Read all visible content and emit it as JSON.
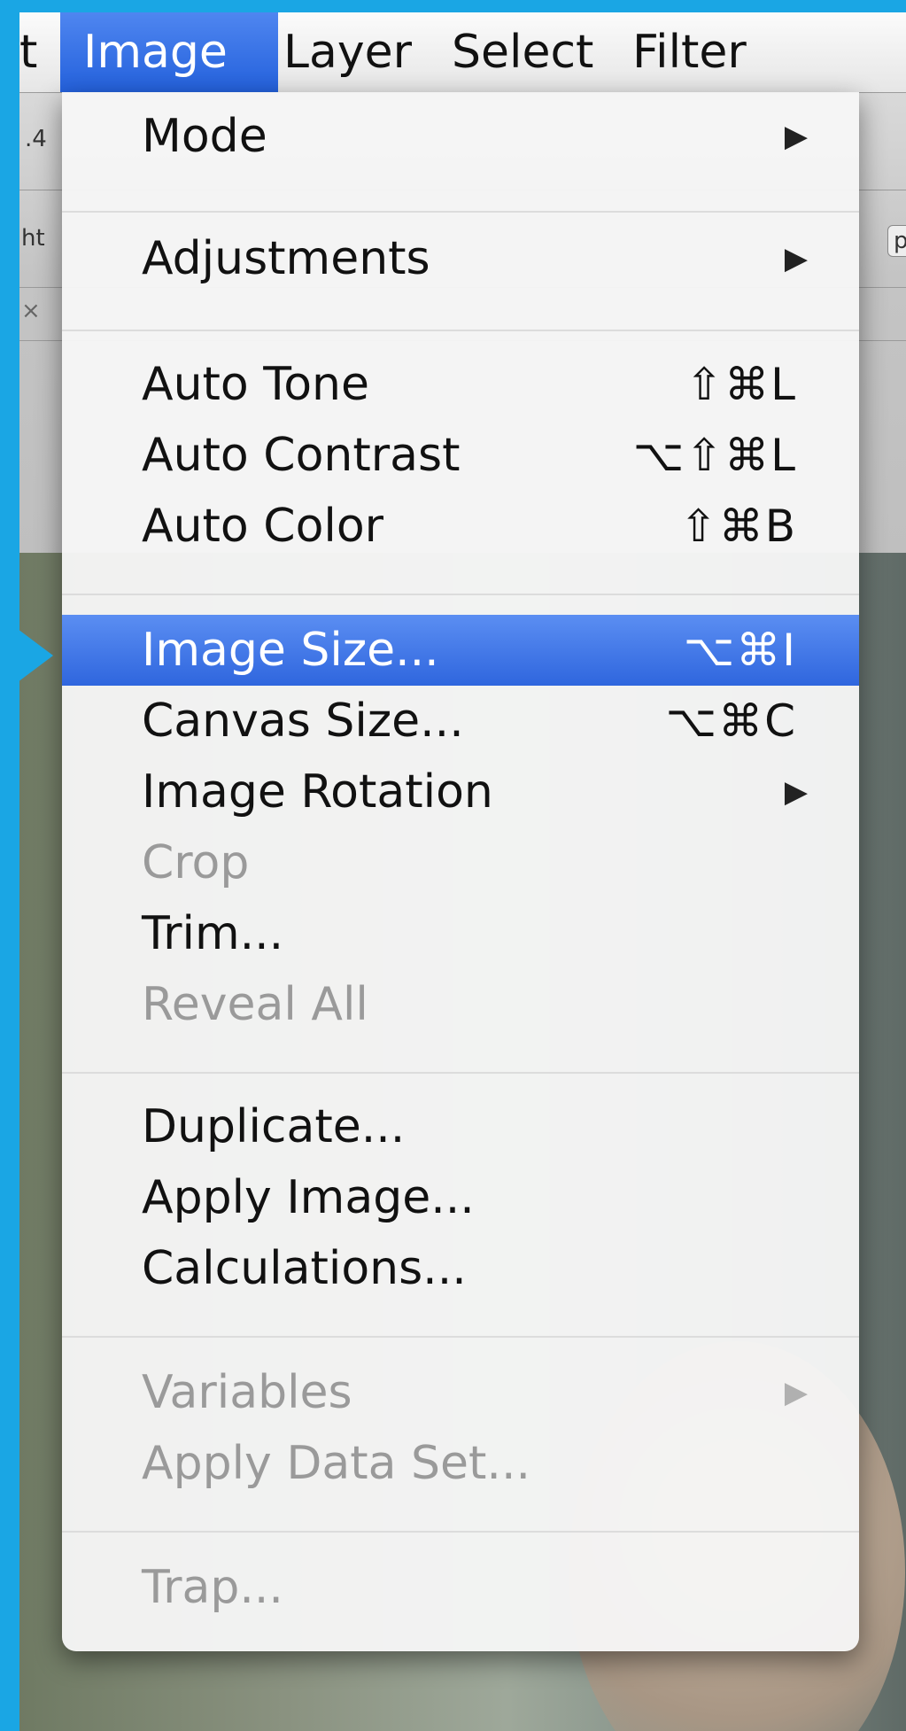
{
  "menubar": {
    "items": [
      {
        "label": "t"
      },
      {
        "label": "Image"
      },
      {
        "label": "Layer"
      },
      {
        "label": "Select"
      },
      {
        "label": "Filter"
      }
    ]
  },
  "background_fragments": {
    "toolbar_value": ".4",
    "option_text": "ht",
    "button_text": "p",
    "close_glyph": "×"
  },
  "image_menu": {
    "items": [
      {
        "label": "Mode",
        "shortcut": "",
        "submenu": true,
        "enabled": true
      },
      {
        "label": "Adjustments",
        "shortcut": "",
        "submenu": true,
        "enabled": true
      },
      {
        "label": "Auto Tone",
        "shortcut": "⇧⌘L",
        "submenu": false,
        "enabled": true
      },
      {
        "label": "Auto Contrast",
        "shortcut": "⌥⇧⌘L",
        "submenu": false,
        "enabled": true
      },
      {
        "label": "Auto Color",
        "shortcut": "⇧⌘B",
        "submenu": false,
        "enabled": true
      },
      {
        "label": "Image Size...",
        "shortcut": "⌥⌘I",
        "submenu": false,
        "enabled": true,
        "highlighted": true
      },
      {
        "label": "Canvas Size...",
        "shortcut": "⌥⌘C",
        "submenu": false,
        "enabled": true
      },
      {
        "label": "Image Rotation",
        "shortcut": "",
        "submenu": true,
        "enabled": true
      },
      {
        "label": "Crop",
        "shortcut": "",
        "submenu": false,
        "enabled": false
      },
      {
        "label": "Trim...",
        "shortcut": "",
        "submenu": false,
        "enabled": true
      },
      {
        "label": "Reveal All",
        "shortcut": "",
        "submenu": false,
        "enabled": false
      },
      {
        "label": "Duplicate...",
        "shortcut": "",
        "submenu": false,
        "enabled": true
      },
      {
        "label": "Apply Image...",
        "shortcut": "",
        "submenu": false,
        "enabled": true
      },
      {
        "label": "Calculations...",
        "shortcut": "",
        "submenu": false,
        "enabled": true
      },
      {
        "label": "Variables",
        "shortcut": "",
        "submenu": true,
        "enabled": false
      },
      {
        "label": "Apply Data Set...",
        "shortcut": "",
        "submenu": false,
        "enabled": false
      },
      {
        "label": "Trap...",
        "shortcut": "",
        "submenu": false,
        "enabled": false
      }
    ],
    "submenu_arrow": "▶"
  },
  "colors": {
    "frame_accent": "#1aa6e4",
    "highlight": "#3a6fe2",
    "disabled_text": "#9a9a9a"
  }
}
